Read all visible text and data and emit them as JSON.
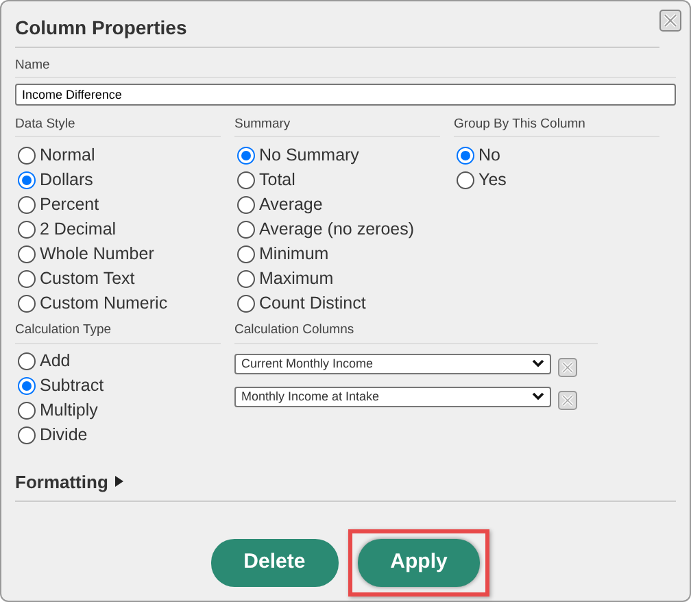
{
  "window": {
    "title": "Column Properties"
  },
  "name_field": {
    "label": "Name",
    "value": "Income Difference"
  },
  "data_style": {
    "label": "Data Style",
    "options": [
      {
        "label": "Normal",
        "selected": false
      },
      {
        "label": "Dollars",
        "selected": true
      },
      {
        "label": "Percent",
        "selected": false
      },
      {
        "label": "2 Decimal",
        "selected": false
      },
      {
        "label": "Whole Number",
        "selected": false
      },
      {
        "label": "Custom Text",
        "selected": false
      },
      {
        "label": "Custom Numeric",
        "selected": false
      }
    ]
  },
  "summary": {
    "label": "Summary",
    "options": [
      {
        "label": "No Summary",
        "selected": true
      },
      {
        "label": "Total",
        "selected": false
      },
      {
        "label": "Average",
        "selected": false
      },
      {
        "label": "Average (no zeroes)",
        "selected": false
      },
      {
        "label": "Minimum",
        "selected": false
      },
      {
        "label": "Maximum",
        "selected": false
      },
      {
        "label": "Count Distinct",
        "selected": false
      }
    ]
  },
  "group_by": {
    "label": "Group By This Column",
    "options": [
      {
        "label": "No",
        "selected": true
      },
      {
        "label": "Yes",
        "selected": false
      }
    ]
  },
  "calculation_type": {
    "label": "Calculation Type",
    "options": [
      {
        "label": "Add",
        "selected": false
      },
      {
        "label": "Subtract",
        "selected": true
      },
      {
        "label": "Multiply",
        "selected": false
      },
      {
        "label": "Divide",
        "selected": false
      }
    ]
  },
  "calculation_columns": {
    "label": "Calculation Columns",
    "columns": [
      {
        "value": "Current Monthly Income"
      },
      {
        "value": "Monthly Income at Intake"
      }
    ]
  },
  "formatting": {
    "label": "Formatting",
    "expanded": false
  },
  "buttons": [
    {
      "label": "Delete",
      "highlighted": false
    },
    {
      "label": "Apply",
      "highlighted": true
    }
  ]
}
